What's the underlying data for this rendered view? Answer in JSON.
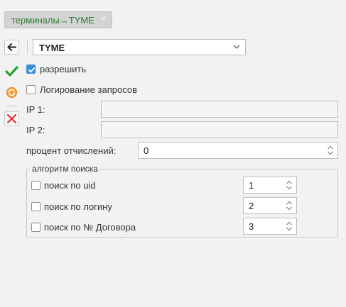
{
  "tab": {
    "label": "терминалы→TYME",
    "close_glyph": "×"
  },
  "toolbar": {
    "back": {
      "icon": "back-arrow-icon"
    },
    "save": {
      "icon": "check-icon",
      "color": "#2aa02a"
    },
    "refresh": {
      "icon": "refresh-icon",
      "color": "#e87a1c"
    },
    "delete": {
      "icon": "delete-x-icon",
      "color": "#e03030"
    }
  },
  "terminal_select": {
    "value": "TYME"
  },
  "allow": {
    "label": "разрешить",
    "checked": true
  },
  "request_logging": {
    "label": "Логирование запросов",
    "checked": false
  },
  "ip1": {
    "label": "IP 1:",
    "value": ""
  },
  "ip2": {
    "label": "IP 2:",
    "value": ""
  },
  "deduction_percent": {
    "label": "процент отчислений:",
    "value": "0"
  },
  "search_algorithm": {
    "title": "алгоритм поиска",
    "options": [
      {
        "label": "поиск по uid",
        "checked": false,
        "order": "1"
      },
      {
        "label": "поиск по логину",
        "checked": false,
        "order": "2"
      },
      {
        "label": "поиск по № Договора",
        "checked": false,
        "order": "3"
      }
    ]
  },
  "colors": {
    "accent": "#3b8fd8",
    "tab_text": "#2e7d32"
  }
}
